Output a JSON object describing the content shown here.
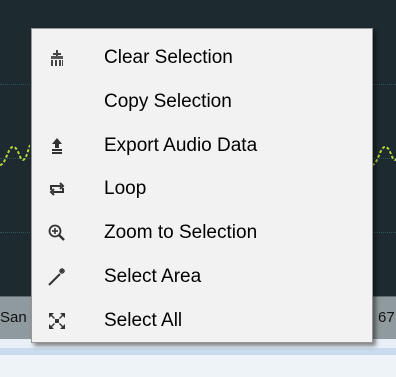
{
  "menu": {
    "items": [
      {
        "label": "Clear Selection",
        "icon": "clear-selection-icon"
      },
      {
        "label": "Copy Selection",
        "icon": ""
      },
      {
        "label": "Export Audio Data",
        "icon": "export-icon"
      },
      {
        "label": "Loop",
        "icon": "loop-icon"
      },
      {
        "label": "Zoom to Selection",
        "icon": "zoom-in-icon"
      },
      {
        "label": "Select Area",
        "icon": "magic-wand-icon"
      },
      {
        "label": "Select All",
        "icon": "select-all-icon"
      }
    ]
  },
  "ruler": {
    "left_text": "San",
    "right_text": "67"
  },
  "colors": {
    "background": "#1d2a2f",
    "waveform": "#b8d63a",
    "menu_bg": "#f2f2f2"
  }
}
